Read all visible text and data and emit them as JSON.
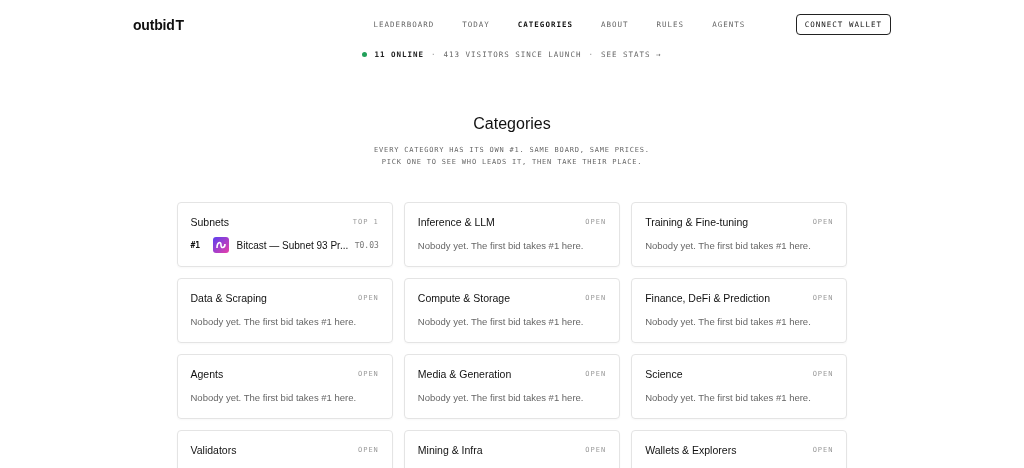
{
  "logo": {
    "text": "outbid",
    "mark": "Τ"
  },
  "nav": [
    {
      "label": "LEADERBOARD",
      "selected": false
    },
    {
      "label": "TODAY",
      "selected": false
    },
    {
      "label": "CATEGORIES",
      "selected": true
    },
    {
      "label": "ABOUT",
      "selected": false
    },
    {
      "label": "RULES",
      "selected": false
    },
    {
      "label": "AGENTS",
      "selected": false
    }
  ],
  "connect_button": "CONNECT WALLET",
  "status": {
    "online": "11 ONLINE",
    "separator_1": "·",
    "visitors": "413 VISITORS SINCE LAUNCH",
    "separator_2": "·",
    "stats_link": "SEE STATS →"
  },
  "heading": "Categories",
  "subtitle": [
    "EVERY CATEGORY HAS ITS OWN #1. SAME BOARD, SAME PRICES.",
    "PICK ONE TO SEE WHO LEADS IT, THEN TAKE THEIR PLACE."
  ],
  "categories": [
    {
      "name": "Subnets",
      "badge": "TOP 1",
      "kind": "leader",
      "rank": "#1",
      "leader": "Bitcast — Subnet 93 Pr...",
      "price": "Τ0.03"
    },
    {
      "name": "Inference & LLM",
      "badge": "OPEN",
      "kind": "empty",
      "text": "Nobody yet. The first bid takes #1 here."
    },
    {
      "name": "Training & Fine-tuning",
      "badge": "OPEN",
      "kind": "empty",
      "text": "Nobody yet. The first bid takes #1 here."
    },
    {
      "name": "Data & Scraping",
      "badge": "OPEN",
      "kind": "empty",
      "text": "Nobody yet. The first bid takes #1 here."
    },
    {
      "name": "Compute & Storage",
      "badge": "OPEN",
      "kind": "empty",
      "text": "Nobody yet. The first bid takes #1 here."
    },
    {
      "name": "Finance, DeFi & Prediction",
      "badge": "OPEN",
      "kind": "empty",
      "text": "Nobody yet. The first bid takes #1 here."
    },
    {
      "name": "Agents",
      "badge": "OPEN",
      "kind": "empty",
      "text": "Nobody yet. The first bid takes #1 here."
    },
    {
      "name": "Media & Generation",
      "badge": "OPEN",
      "kind": "empty",
      "text": "Nobody yet. The first bid takes #1 here."
    },
    {
      "name": "Science",
      "badge": "OPEN",
      "kind": "empty",
      "text": "Nobody yet. The first bid takes #1 here."
    },
    {
      "name": "Validators",
      "badge": "OPEN",
      "kind": "cut"
    },
    {
      "name": "Mining & Infra",
      "badge": "OPEN",
      "kind": "cut"
    },
    {
      "name": "Wallets & Explorers",
      "badge": "OPEN",
      "kind": "cut"
    }
  ]
}
